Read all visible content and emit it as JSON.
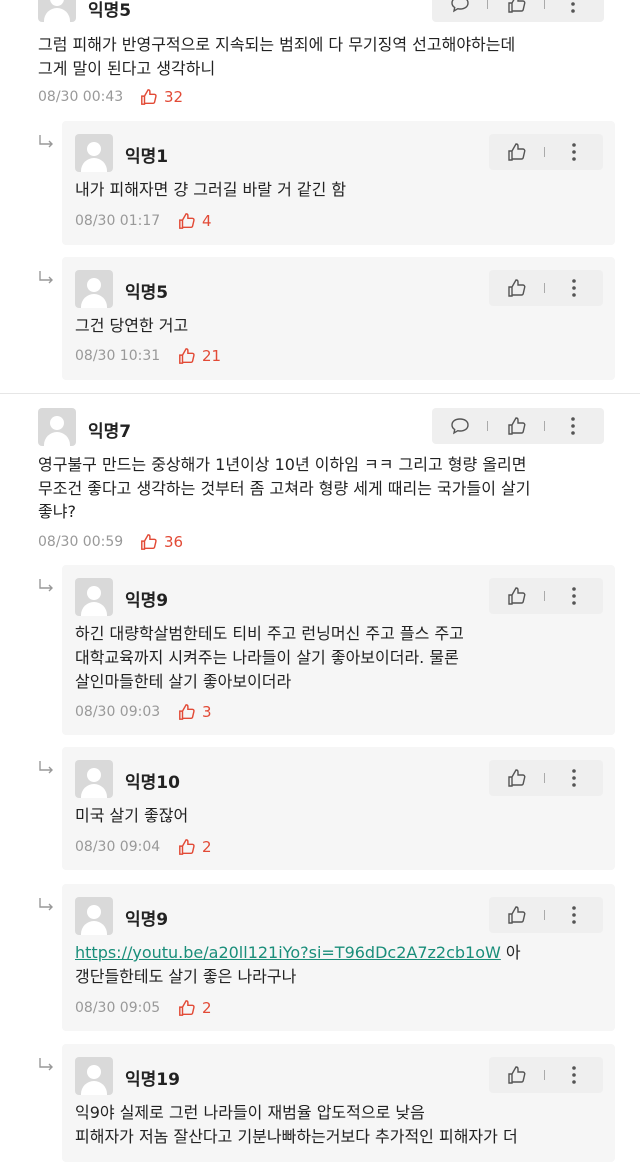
{
  "comments": [
    {
      "author": "익명5",
      "lines": [
        "그럼 피해가 반영구적으로 지속되는 범죄에 다 무기징역 선고해야하는데",
        "그게 말이 된다고 생각하니"
      ],
      "time": "08/30 00:43",
      "likes": "32",
      "replies": [
        {
          "author": "익명1",
          "lines": [
            "내가 피해자면 걍 그러길 바랄 거 같긴 함"
          ],
          "time": "08/30 01:17",
          "likes": "4"
        },
        {
          "author": "익명5",
          "lines": [
            "그건 당연한 거고"
          ],
          "time": "08/30 10:31",
          "likes": "21"
        }
      ]
    },
    {
      "author": "익명7",
      "lines": [
        "영구불구 만드는 중상해가 1년이상 10년 이하임 ㅋㅋ 그리고 형량 올리면",
        "무조건 좋다고 생각하는 것부터 좀 고쳐라 형량 세게 때리는 국가들이 살기",
        "좋냐?"
      ],
      "time": "08/30 00:59",
      "likes": "36",
      "replies": [
        {
          "author": "익명9",
          "lines": [
            "하긴 대량학살범한테도 티비 주고 런닝머신 주고 플스 주고",
            "대학교육까지 시켜주는 나라들이 살기 좋아보이더라. 물론",
            "살인마들한테 살기 좋아보이더라"
          ],
          "time": "08/30 09:03",
          "likes": "3"
        },
        {
          "author": "익명10",
          "lines": [
            "미국 살기 좋잖어"
          ],
          "time": "08/30 09:04",
          "likes": "2"
        },
        {
          "author": "익명9",
          "link": "https://youtu.be/a20ll121iYo?si=T96dDc2A7z2cb1oW",
          "link_suffix": " 아",
          "lines": [
            "갱단들한테도 살기 좋은 나라구나"
          ],
          "time": "08/30 09:05",
          "likes": "2"
        },
        {
          "author": "익명19",
          "lines": [
            "익9야 실제로 그런 나라들이 재범율 압도적으로 낮음",
            "피해자가 저놈 잘산다고 기분나빠하는거보다 추가적인 피해자가 더"
          ],
          "time": "",
          "likes": ""
        }
      ]
    }
  ],
  "colors": {
    "accent": "#e24a36",
    "link": "#1a8e7a",
    "reply_bg": "#f6f6f6",
    "action_bg": "#efefef"
  },
  "icons": {
    "reply_arrow": "reply-arrow-icon",
    "comment": "comment-icon",
    "like": "thumbs-up-icon",
    "more": "more-vertical-icon"
  }
}
